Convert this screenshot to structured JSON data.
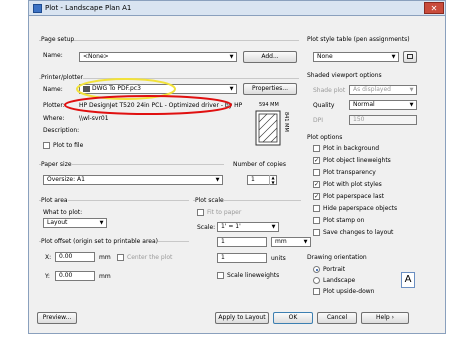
{
  "title": "Plot - Landscape Plan A1",
  "close_glyph": "✕",
  "page_setup": {
    "group": "Page setup",
    "name_label": "Name:",
    "name_value": "<None>",
    "add_button": "Add..."
  },
  "printer": {
    "group": "Printer/plotter",
    "name_label": "Name:",
    "name_value": "DWG To PDF.pc3",
    "properties_button": "Properties...",
    "plotter_label": "Plotter:",
    "plotter_value": "HP DesignJet T520 24in PCL - Optimized driver - by HP",
    "where_label": "Where:",
    "where_value": "\\\\wl-svr01",
    "description_label": "Description:",
    "plot_to_file": "Plot to file",
    "preview_width": "594 MM",
    "preview_height": "841 MM"
  },
  "paper_size": {
    "group": "Paper size",
    "value": "Oversize: A1"
  },
  "copies": {
    "group": "Number of copies",
    "value": "1"
  },
  "plot_area": {
    "group": "Plot area",
    "what_label": "What to plot:",
    "what_value": "Layout"
  },
  "plot_offset": {
    "group": "Plot offset (origin set to printable area)",
    "x_label": "X:",
    "x_value": "0.00",
    "x_unit": "mm",
    "y_label": "Y:",
    "y_value": "0.00",
    "y_unit": "mm",
    "center": "Center the plot"
  },
  "plot_scale": {
    "group": "Plot scale",
    "fit": "Fit to paper",
    "scale_label": "Scale:",
    "scale_value": "1' = 1'",
    "v1": "1",
    "unit_value": "mm",
    "v2": "1",
    "units_label": "units",
    "lineweights": "Scale lineweights"
  },
  "style_table": {
    "group": "Plot style table (pen assignments)",
    "value": "None"
  },
  "shaded": {
    "group": "Shaded viewport options",
    "shade_label": "Shade plot",
    "shade_value": "As displayed",
    "quality_label": "Quality",
    "quality_value": "Normal",
    "dpi_label": "DPI",
    "dpi_value": "150"
  },
  "plot_options": {
    "group": "Plot options",
    "items": [
      {
        "label": "Plot in background",
        "checked": false
      },
      {
        "label": "Plot object lineweights",
        "checked": true
      },
      {
        "label": "Plot transparency",
        "checked": false
      },
      {
        "label": "Plot with plot styles",
        "checked": true
      },
      {
        "label": "Plot paperspace last",
        "checked": true
      },
      {
        "label": "Hide paperspace objects",
        "checked": false
      },
      {
        "label": "Plot stamp on",
        "checked": false
      },
      {
        "label": "Save changes to layout",
        "checked": false
      }
    ]
  },
  "orientation": {
    "group": "Drawing orientation",
    "portrait": "Portrait",
    "landscape": "Landscape",
    "upside": "Plot upside-down",
    "icon": "A"
  },
  "buttons": {
    "preview": "Preview...",
    "apply": "Apply to Layout",
    "ok": "OK",
    "cancel": "Cancel",
    "help": "Help"
  },
  "colors": {
    "annotation_red": "#e01010",
    "annotation_yellow": "#f2e23a"
  }
}
